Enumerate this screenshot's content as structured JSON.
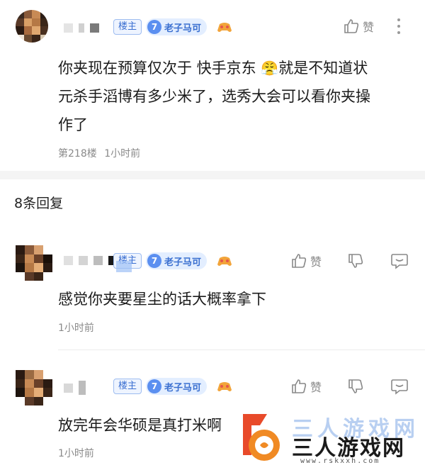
{
  "main_comment": {
    "host_badge": "楼主",
    "level": "7",
    "level_title": "老子马可",
    "like_label": "赞",
    "text_lines": [
      "你夹现在预算仅次于 快手京东",
      "元杀手滔博有多少米了，选秀大会可以看你夹操",
      "作了"
    ],
    "emoji": "😤",
    "text_line1_suffix": "就是不知道状",
    "floor": "第218楼",
    "time": "1小时前"
  },
  "reply_count": "8条回复",
  "replies": [
    {
      "host_badge": "楼主",
      "level": "7",
      "level_title": "老子马可",
      "like_label": "赞",
      "text": "感觉你夹要星尘的话大概率拿下",
      "time": "1小时前"
    },
    {
      "host_badge": "楼主",
      "level": "7",
      "level_title": "老子马可",
      "like_label": "赞",
      "text": "放完年会华硕是真打米啊",
      "time": "1小时前"
    }
  ],
  "watermark": {
    "name": "三人游戏网",
    "url": "www.rskxxh.com"
  },
  "colors": {
    "accent": "#3b6fd1",
    "meta": "#8a8a8a",
    "watermark_orange": "#f08a24"
  }
}
